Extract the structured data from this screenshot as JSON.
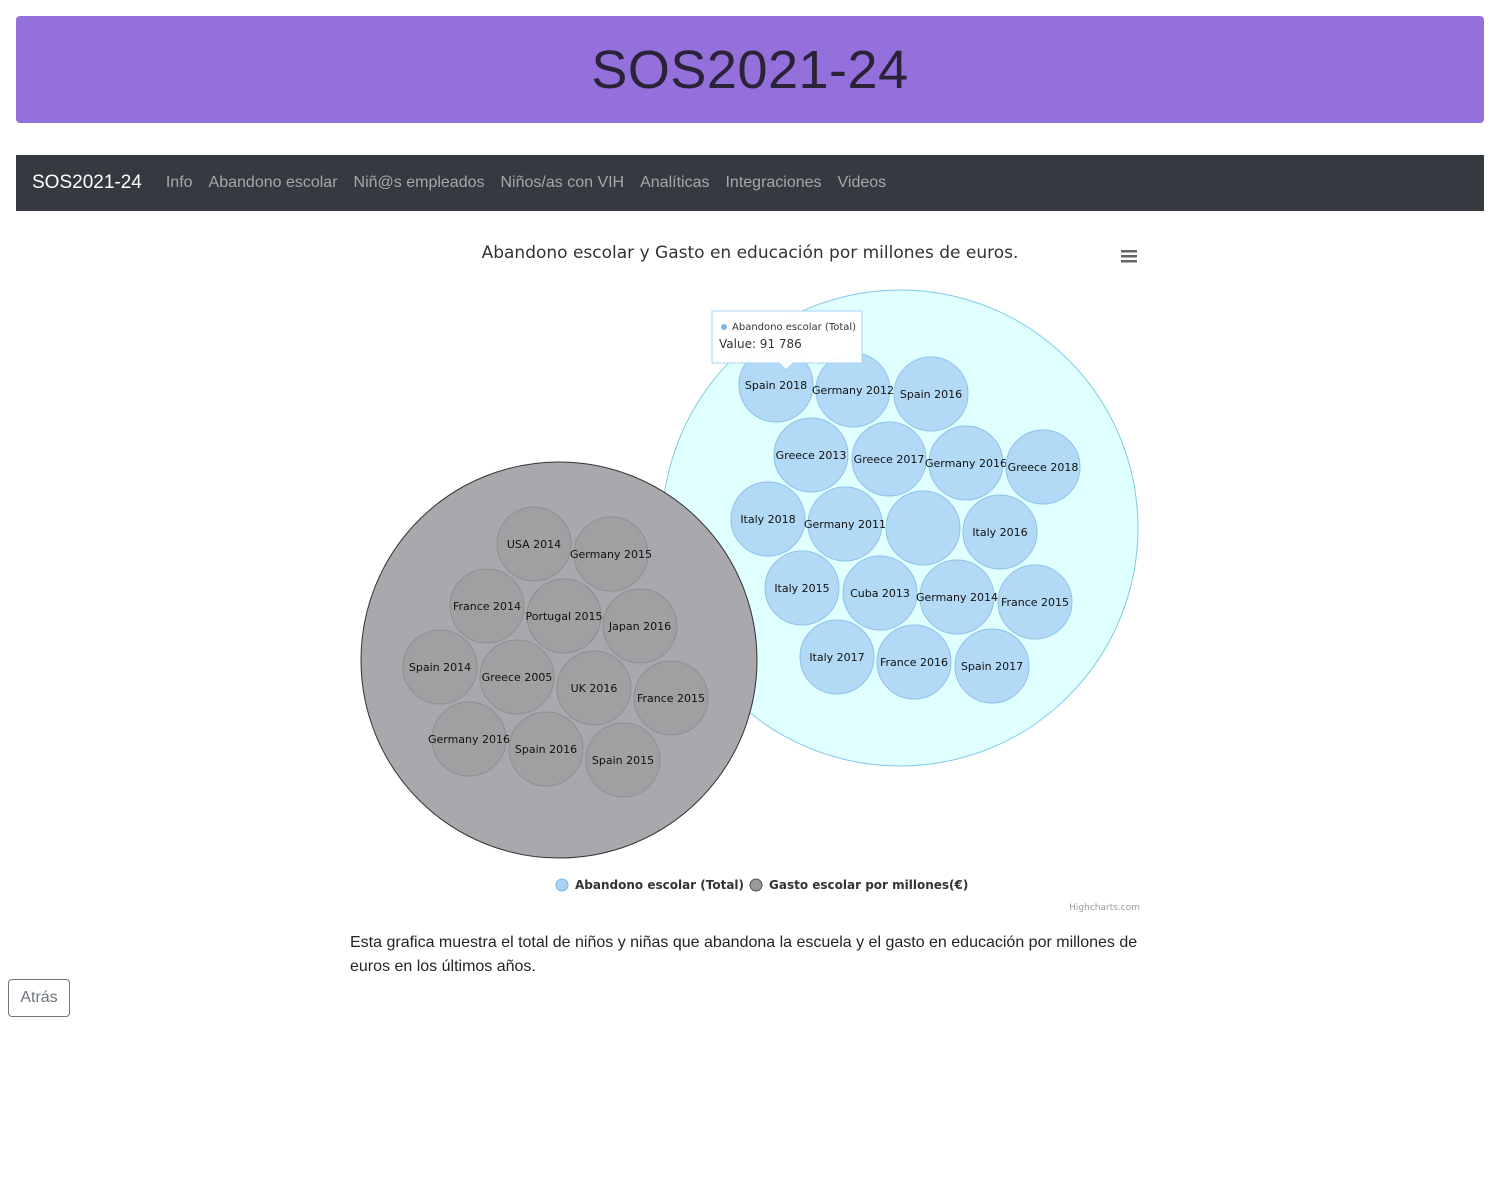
{
  "header": {
    "title": "SOS2021-24"
  },
  "navbar": {
    "brand": "SOS2021-24",
    "links": [
      "Info",
      "Abandono escolar",
      "Niñ@s empleados",
      "Niños/as con VIH",
      "Analíticas",
      "Integraciones",
      "Videos"
    ]
  },
  "chart_data": {
    "type": "packedbubble",
    "title": "Abandono escolar y Gasto en educación por millones de euros.",
    "legend_position": "bottom-center",
    "credits": "Highcharts.com",
    "series": [
      {
        "name": "Abandono escolar (Total)",
        "color": "#a9d3f5",
        "container_color": "#e0ffff",
        "points": [
          "Spain 2018",
          "Germany 2012",
          "Spain 2016",
          "Greece 2013",
          "Greece 2017",
          "Germany 2016",
          "Greece 2018",
          "Italy 2018",
          "Germany 2011",
          "",
          "Italy 2016",
          "Italy 2015",
          "Cuba 2013",
          "Germany 2014",
          "France 2015",
          "Italy 2017",
          "France 2016",
          "Spain 2017"
        ]
      },
      {
        "name": "Gasto escolar por millones(€)",
        "color": "#999999",
        "container_color": "#a9a9ad",
        "points": [
          "USA 2014",
          "Germany 2015",
          "France 2014",
          "Portugal 2015",
          "Japan 2016",
          "Spain 2014",
          "Greece 2005",
          "UK 2016",
          "France 2015",
          "Germany 2016",
          "Spain 2016",
          "Spain 2015"
        ]
      }
    ],
    "tooltip": {
      "series": "Abandono escolar (Total)",
      "value_text": "Value: 91 786",
      "point": "Spain 2018"
    }
  },
  "description": "Esta grafica muestra el total de niños y niñas que abandona la escuela y el gasto en educación por millones de euros en los últimos años.",
  "back_button": {
    "label": "Atrás"
  }
}
